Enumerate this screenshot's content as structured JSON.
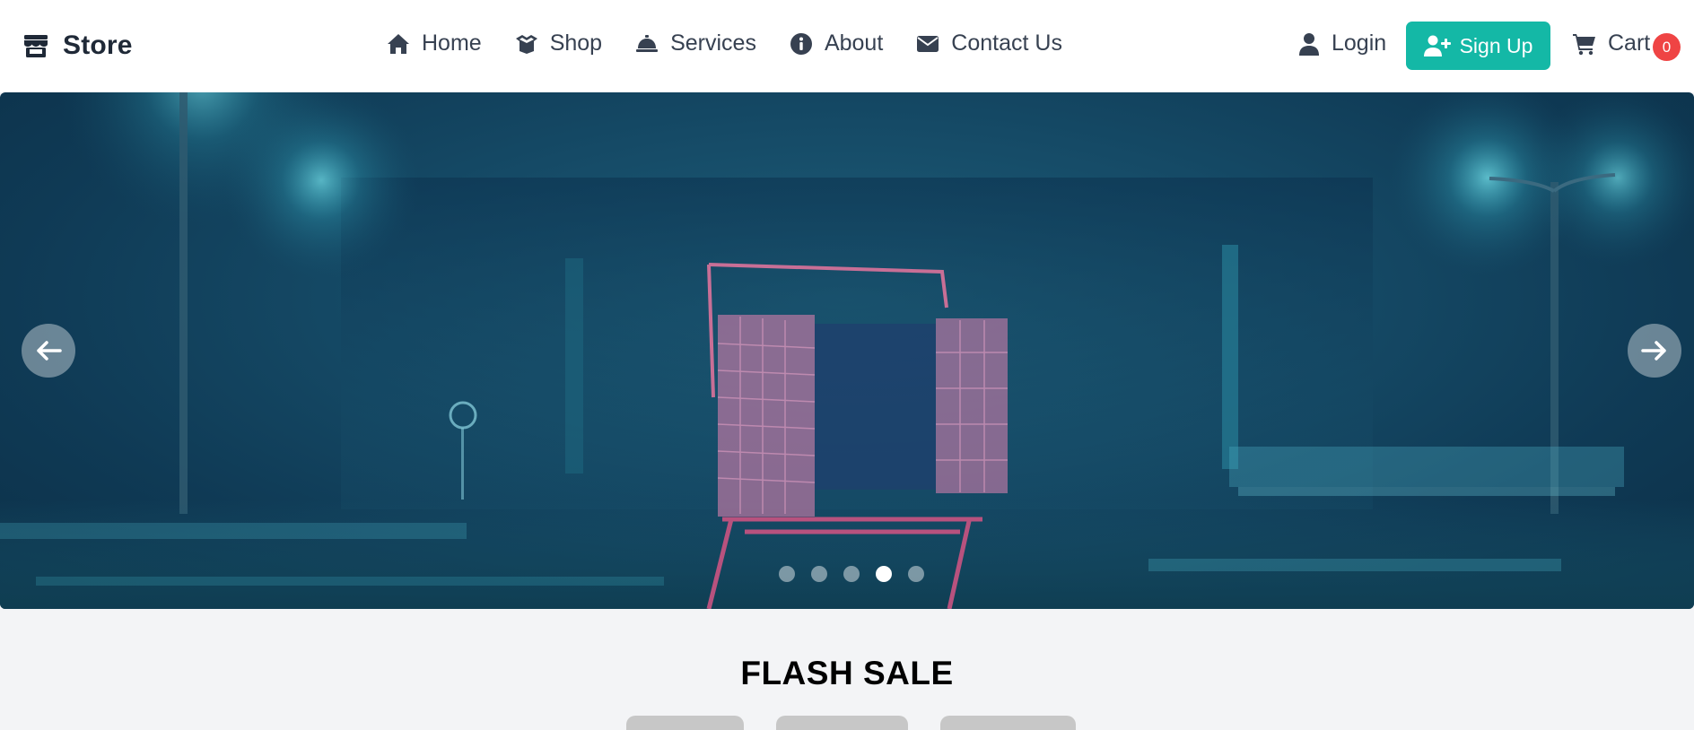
{
  "brand": {
    "name": "Store",
    "icon": "store-icon"
  },
  "nav": {
    "items": [
      {
        "label": "Home",
        "icon": "home-icon"
      },
      {
        "label": "Shop",
        "icon": "box-open-icon"
      },
      {
        "label": "Services",
        "icon": "concierge-bell-icon"
      },
      {
        "label": "About",
        "icon": "info-circle-icon"
      },
      {
        "label": "Contact Us",
        "icon": "envelope-icon"
      }
    ]
  },
  "account": {
    "login_label": "Login",
    "signup_label": "Sign Up",
    "cart_label": "Cart",
    "cart_count": "0"
  },
  "carousel": {
    "slide_count": 5,
    "active_index": 3,
    "prev_icon": "arrow-left-icon",
    "next_icon": "arrow-right-icon"
  },
  "flash_sale": {
    "title": "FLASH SALE"
  },
  "colors": {
    "accent": "#14b8a6",
    "badge": "#ef4444",
    "text": "#374151",
    "background": "#f3f4f6"
  }
}
